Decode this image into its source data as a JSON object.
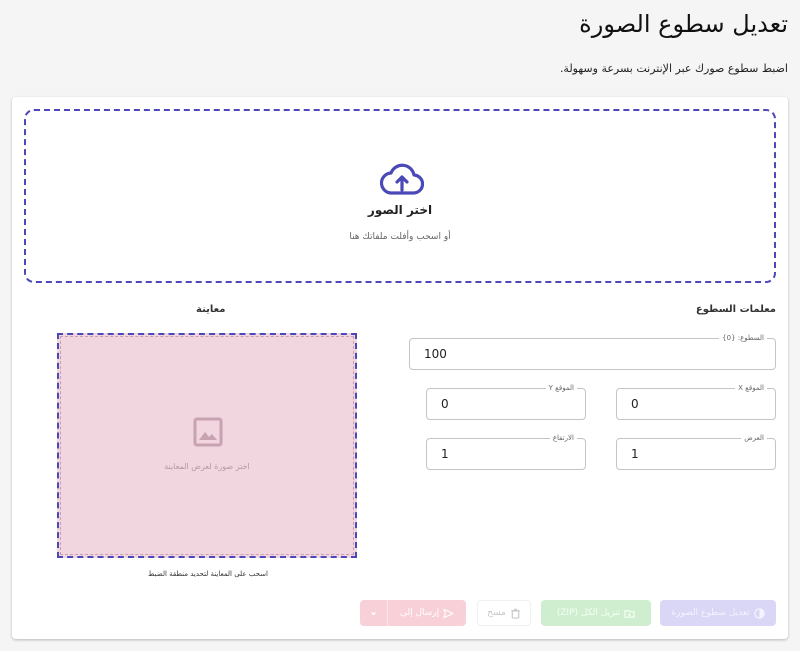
{
  "page": {
    "title": "تعديل سطوع الصورة",
    "subtitle": "اضبط سطوع صورك عبر الإنترنت بسرعة وسهولة."
  },
  "dropzone": {
    "title": "اختر الصور",
    "hint": "أو اسحب وأفلت ملفاتك هنا",
    "icon": "cloud-upload-icon"
  },
  "params": {
    "section_label": "معلمات السطوع",
    "brightness": {
      "label": "السطوع: {0}",
      "value": "100"
    },
    "pos_x": {
      "label": "الموقع X",
      "value": "0"
    },
    "pos_y": {
      "label": "الموقع Y",
      "value": "0"
    },
    "width": {
      "label": "العرض",
      "value": "1"
    },
    "height": {
      "label": "الارتفاع",
      "value": "1"
    }
  },
  "preview": {
    "section_label": "معاينة",
    "placeholder": "اختر صورة لعرض المعاينة",
    "caption": "اسحب على المعاينة لتحديد منطقة الضبط",
    "icon": "image-icon"
  },
  "actions": {
    "edit_label": "تعديل سطوع الصورة",
    "zip_label": "تنزيل الكل (ZIP)",
    "clear_label": "مسح",
    "send_label": "إرسال إلى"
  },
  "colors": {
    "accent": "#4b48b8",
    "preview_bg": "#f2d6df",
    "edit_button": "#d9d7f5",
    "zip_button": "#cfeecf",
    "send_button": "#f8d1d8"
  }
}
